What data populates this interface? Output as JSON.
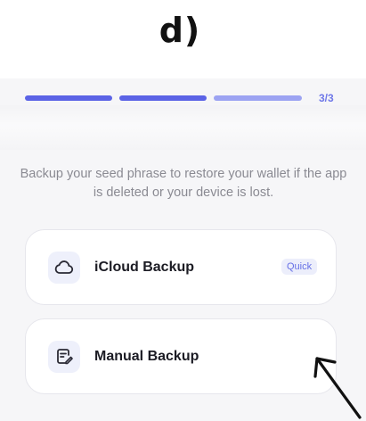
{
  "panel_label": "d)",
  "progress": {
    "step_text": "3/3",
    "total_steps": 3,
    "current_step": 3,
    "filled_color": "#5b63e6",
    "current_color": "#9ca3f2"
  },
  "description": "Backup your seed phrase to restore your wallet if the app is deleted or your device is lost.",
  "options": [
    {
      "label": "iCloud Backup",
      "badge": "Quick",
      "icon": "cloud-icon"
    },
    {
      "label": "Manual Backup",
      "icon": "note-edit-icon"
    }
  ],
  "annotation": {
    "icon": "arrow-pointer-icon"
  }
}
